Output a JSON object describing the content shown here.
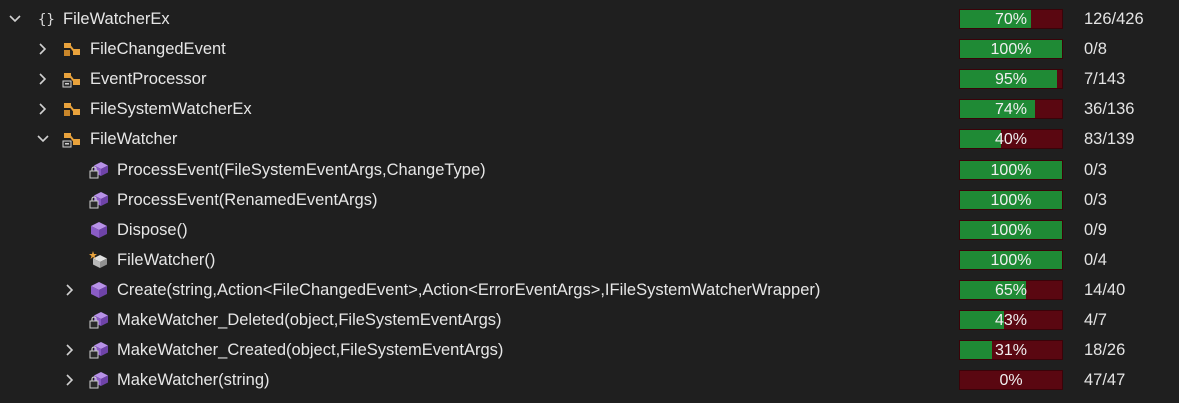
{
  "tree": {
    "rows": [
      {
        "name": "FileWatcherEx",
        "percent_label": "70%",
        "coverage": 0.7,
        "count": "126/426",
        "icon": "namespace-icon",
        "expander": "expanded"
      },
      {
        "name": "FileChangedEvent",
        "percent_label": "100%",
        "coverage": 1.0,
        "count": "0/8",
        "icon": "class-icon",
        "expander": "collapsed"
      },
      {
        "name": "EventProcessor",
        "percent_label": "95%",
        "coverage": 0.95,
        "count": "7/143",
        "icon": "internal-class-icon",
        "expander": "collapsed"
      },
      {
        "name": "FileSystemWatcherEx",
        "percent_label": "74%",
        "coverage": 0.74,
        "count": "36/136",
        "icon": "class-icon",
        "expander": "collapsed"
      },
      {
        "name": "FileWatcher",
        "percent_label": "40%",
        "coverage": 0.4,
        "count": "83/139",
        "icon": "internal-class-icon",
        "expander": "expanded"
      },
      {
        "name": "ProcessEvent(FileSystemEventArgs,ChangeType)",
        "percent_label": "100%",
        "coverage": 1.0,
        "count": "0/3",
        "icon": "private-method-icon",
        "expander": "none"
      },
      {
        "name": "ProcessEvent(RenamedEventArgs)",
        "percent_label": "100%",
        "coverage": 1.0,
        "count": "0/3",
        "icon": "private-method-icon",
        "expander": "none"
      },
      {
        "name": "Dispose()",
        "percent_label": "100%",
        "coverage": 1.0,
        "count": "0/9",
        "icon": "method-icon",
        "expander": "none"
      },
      {
        "name": "FileWatcher()",
        "percent_label": "100%",
        "coverage": 1.0,
        "count": "0/4",
        "icon": "constructor-icon",
        "expander": "none"
      },
      {
        "name": "Create(string,Action<FileChangedEvent>,Action<ErrorEventArgs>,IFileSystemWatcherWrapper)",
        "percent_label": "65%",
        "coverage": 0.65,
        "count": "14/40",
        "icon": "method-icon",
        "expander": "collapsed"
      },
      {
        "name": "MakeWatcher_Deleted(object,FileSystemEventArgs)",
        "percent_label": "43%",
        "coverage": 0.43,
        "count": "4/7",
        "icon": "private-method-icon",
        "expander": "none"
      },
      {
        "name": "MakeWatcher_Created(object,FileSystemEventArgs)",
        "percent_label": "31%",
        "coverage": 0.31,
        "count": "18/26",
        "icon": "private-method-icon",
        "expander": "collapsed"
      },
      {
        "name": "MakeWatcher(string)",
        "percent_label": "0%",
        "coverage": 0.0,
        "count": "47/47",
        "icon": "private-method-icon",
        "expander": "collapsed"
      }
    ]
  },
  "colors": {
    "covered": "#1f8a35",
    "uncovered": "#5a0711",
    "background": "#1f1f1f",
    "class_icon": "#e8a23c",
    "method_icon": "#9b6fd1"
  }
}
